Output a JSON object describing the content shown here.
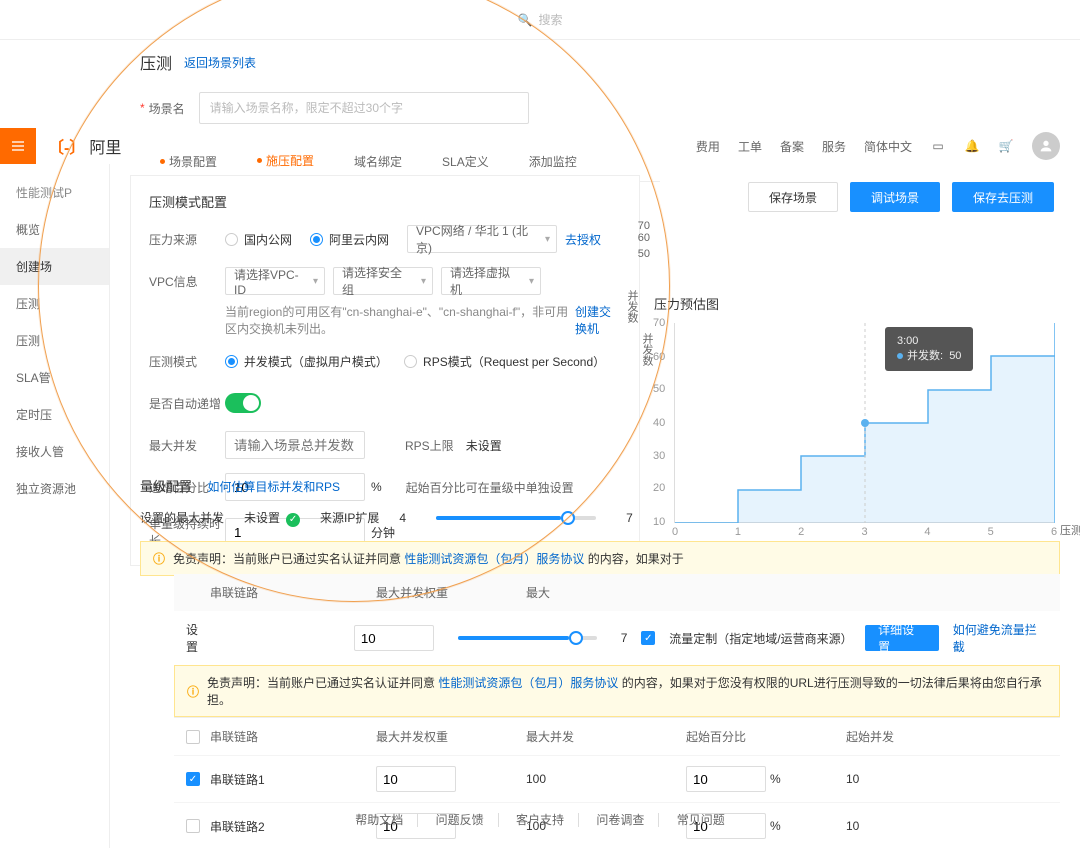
{
  "search_placeholder": "搜索",
  "header": {
    "brand": "阿里",
    "links": [
      "费用",
      "工单",
      "备案",
      "服务",
      "简体中文"
    ]
  },
  "sidebar": {
    "title": "性能测试P",
    "items": [
      "概览",
      "创建场",
      "压测",
      "压测",
      "SLA管",
      "定时压",
      "接收人管",
      "独立资源池"
    ],
    "active": 1
  },
  "scene": {
    "crumb": "压测",
    "back": "返回场景列表",
    "name_label": "场景名",
    "name_ph": "请输入场景名称，限定不超过30个字"
  },
  "tabs": [
    {
      "label": "场景配置",
      "dot": true
    },
    {
      "label": "施压配置",
      "dot": true,
      "active": true
    },
    {
      "label": "域名绑定"
    },
    {
      "label": "SLA定义"
    },
    {
      "label": "添加监控"
    }
  ],
  "cfg": {
    "title": "压测模式配置",
    "src_label": "压力来源",
    "src_opts": [
      "国内公网",
      "阿里云内网"
    ],
    "vpc_select": "VPC网络 / 华北 1 (北京)",
    "auth": "去授权",
    "vpcinfo_label": "VPC信息",
    "vpc_id": "请选择VPC-ID",
    "sec_group": "请选择安全组",
    "vm": "请选择虚拟机",
    "region_hint_a": "当前region的可用区有\"cn-shanghai-e\"、\"cn-shanghai-f\"，非可用区内交换机未列出。",
    "region_hint_link": "创建交换机",
    "mode_label": "压测模式",
    "mode_a": "并发模式（虚拟用户模式）",
    "mode_b": "RPS模式（Request per Second）",
    "auto_label": "是否自动递增",
    "max_label": "最大并发",
    "max_ph": "请输入场景总并发数",
    "rps_label": "RPS上限",
    "rps_val": "未设置",
    "inc_label": "递增百分比",
    "inc_val": "10",
    "inc_unit": "%",
    "start_hint": "起始百分比可在量级中单独设置",
    "dur_label": "单量级持续时长",
    "dur_val": "1",
    "dur_unit": "分钟"
  },
  "actions": {
    "save": "保存场景",
    "debug": "调试场景",
    "go": "保存去压测"
  },
  "qty": {
    "title": "量级配置",
    "help": "如何估算目标并发和RPS",
    "max_label": "设置的最大并发",
    "max_val": "未设置",
    "ip_label": "来源IP扩展",
    "slider_min": "4",
    "slider_max": "7",
    "notice_pre": "免责声明：当前账户已通过实名认证并同意 ",
    "notice_link": "性能测试资源包（包月）服务协议",
    "notice_post": " 的内容，如果对于",
    "notice2_pre": "免责声明：当前账户已通过实名认证并同意 ",
    "notice2_link": "性能测试资源包（包月）服务协议",
    "notice2_post": " 的内容，如果对于您没有权限的URL进行压测导致的一切法律后果将由您自行承担。"
  },
  "mid": {
    "h1": "串联链路",
    "h2": "最大并发权重",
    "h3": "最大",
    "set_lbl": "设置",
    "inp": "10",
    "slider_max": "7",
    "traffic_lbl": "流量定制（指定地域/运营商来源）",
    "detail_btn": "详细设置",
    "avoid": "如何避免流量拦截"
  },
  "table": {
    "headers": [
      "串联链路",
      "最大并发权重",
      "最大并发",
      "起始百分比",
      "起始并发"
    ],
    "rows": [
      {
        "checked": true,
        "name": "串联链路1",
        "w": "10",
        "max": "100",
        "pct": "10",
        "start": "10"
      },
      {
        "checked": false,
        "name": "串联链路2",
        "w": "10",
        "max": "100",
        "pct": "10",
        "start": "10"
      }
    ]
  },
  "chart_title": "压力预估图",
  "chart_axis_y": "并发数",
  "chart_axis_x": "压测时长",
  "chart_tt_time": "3:00",
  "chart_tt_series": "并发数:",
  "chart_tt_val": "50",
  "chart_data": {
    "type": "line",
    "x": [
      0,
      1,
      2,
      3,
      4,
      5,
      6
    ],
    "values": [
      10,
      20,
      30,
      40,
      50,
      60,
      70
    ],
    "xlabel": "压测时长",
    "ylabel": "并发数",
    "ylim": [
      10,
      70
    ],
    "highlight": {
      "x": 3,
      "y": 50
    }
  },
  "footer": [
    "帮助文档",
    "问题反馈",
    "客户支持",
    "问卷调查",
    "常见问题"
  ]
}
